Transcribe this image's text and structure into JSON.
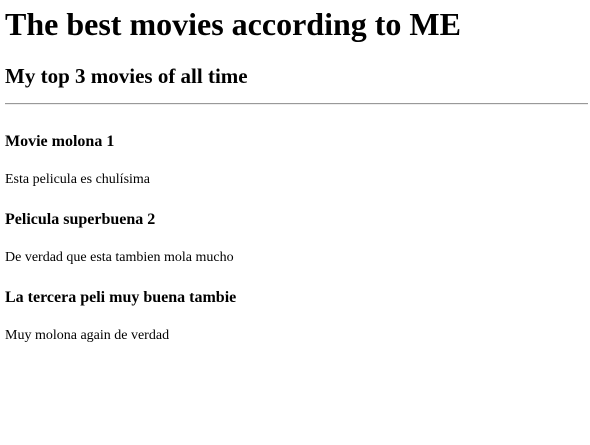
{
  "title": "The best movies according to ME",
  "subtitle": "My top 3 movies of all time",
  "movies": [
    {
      "title": "Movie molona 1",
      "description": "Esta pelicula es chulísima"
    },
    {
      "title": "Pelicula superbuena 2",
      "description": "De verdad que esta tambien mola mucho"
    },
    {
      "title": "La tercera peli muy buena tambie",
      "description": "Muy molona again de verdad"
    }
  ]
}
